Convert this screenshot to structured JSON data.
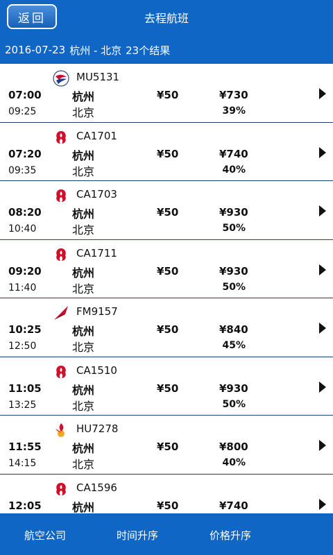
{
  "header": {
    "back_label": "返回",
    "title": "去程航班",
    "date": "2016-07-23",
    "route": "杭州 - 北京",
    "result_count": "23个结果"
  },
  "colors": {
    "brand_blue": "#0f66c4",
    "row_divider": "#1e3f6c"
  },
  "flights": [
    {
      "airline_icon": "china-eastern-logo-icon",
      "flight_no": "MU5131",
      "dep_time": "07:00",
      "arr_time": "09:25",
      "dep_city": "杭州",
      "arr_city": "北京",
      "tax": "¥50",
      "price": "¥730",
      "discount": "39%"
    },
    {
      "airline_icon": "air-china-logo-icon",
      "flight_no": "CA1701",
      "dep_time": "07:20",
      "arr_time": "09:35",
      "dep_city": "杭州",
      "arr_city": "北京",
      "tax": "¥50",
      "price": "¥740",
      "discount": "40%"
    },
    {
      "airline_icon": "air-china-logo-icon",
      "flight_no": "CA1703",
      "dep_time": "08:20",
      "arr_time": "10:40",
      "dep_city": "杭州",
      "arr_city": "北京",
      "tax": "¥50",
      "price": "¥930",
      "discount": "50%"
    },
    {
      "airline_icon": "air-china-logo-icon",
      "flight_no": "CA1711",
      "dep_time": "09:20",
      "arr_time": "11:40",
      "dep_city": "杭州",
      "arr_city": "北京",
      "tax": "¥50",
      "price": "¥930",
      "discount": "50%"
    },
    {
      "airline_icon": "shanghai-airlines-logo-icon",
      "flight_no": "FM9157",
      "dep_time": "10:25",
      "arr_time": "12:50",
      "dep_city": "杭州",
      "arr_city": "北京",
      "tax": "¥50",
      "price": "¥840",
      "discount": "45%"
    },
    {
      "airline_icon": "air-china-logo-icon",
      "flight_no": "CA1510",
      "dep_time": "11:05",
      "arr_time": "13:25",
      "dep_city": "杭州",
      "arr_city": "北京",
      "tax": "¥50",
      "price": "¥930",
      "discount": "50%"
    },
    {
      "airline_icon": "hainan-airlines-logo-icon",
      "flight_no": "HU7278",
      "dep_time": "11:55",
      "arr_time": "14:15",
      "dep_city": "杭州",
      "arr_city": "北京",
      "tax": "¥50",
      "price": "¥800",
      "discount": "40%"
    },
    {
      "airline_icon": "air-china-logo-icon",
      "flight_no": "CA1596",
      "dep_time": "12:05",
      "arr_time": "",
      "dep_city": "杭州",
      "arr_city": "",
      "tax": "¥50",
      "price": "¥740",
      "discount": ""
    }
  ],
  "bottom_tabs": [
    "航空公司",
    "时间升序",
    "价格升序"
  ]
}
